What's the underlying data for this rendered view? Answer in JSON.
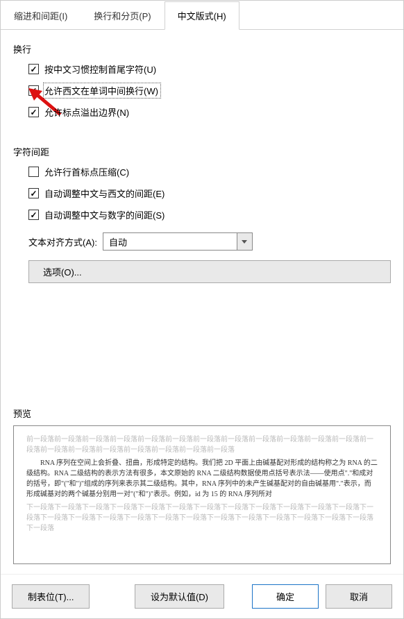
{
  "tabs": {
    "indent": "缩进和间距(I)",
    "page": "换行和分页(P)",
    "chinese": "中文版式(H)"
  },
  "group_linebreak": "换行",
  "checks": {
    "cjk_first_last": "按中文习惯控制首尾字符(U)",
    "latin_wrap": "允许西文在单词中间换行(W)",
    "punct_overflow": "允许标点溢出边界(N)"
  },
  "group_spacing": "字符间距",
  "spacing_checks": {
    "compress_punct": "允许行首标点压缩(C)",
    "auto_cjk_latin": "自动调整中文与西文的间距(E)",
    "auto_cjk_digit": "自动调整中文与数字的间距(S)"
  },
  "align_label": "文本对齐方式(A):",
  "align_value": "自动",
  "options_btn": "选项(O)...",
  "preview_label": "预览",
  "preview": {
    "ghost_before": "前一段落前一段落前一段落前一段落前一段落前一段落前一段落前一段落前一段落前一段落前一段落前一段落前一段落前一段落前一段落前一段落前一段落前一段落前一段落前一段落",
    "core": "RNA 序列在空间上会折叠、扭曲，形成特定的结构。我们把 2D 平面上由碱基配对形成的结构称之为 RNA 的二级结构。RNA 二级结构的表示方法有很多，本文原始的 RNA 二级结构数据使用点括号表示法——使用点\".\"和成对的括号，即\"(\"和\")\"组成的序列来表示其二级结构。其中，RNA 序列中的未产生碱基配对的自由碱基用\".\"表示，而形成碱基对的两个碱基分别用一对\"(\"和\")\"表示。例如，id 为 15 的 RNA 序列所对",
    "ghost_after": "下一段落下一段落下一段落下一段落下一段落下一段落下一段落下一段落下一段落下一段落下一段落下一段落下一段落下一段落下一段落下一段落下一段落下一段落下一段落下一段落下一段落下一段落下一段落下一段落下一段落下一段落"
  },
  "footer": {
    "tabs_btn": "制表位(T)...",
    "default_btn": "设为默认值(D)",
    "ok_btn": "确定",
    "cancel_btn": "取消"
  }
}
